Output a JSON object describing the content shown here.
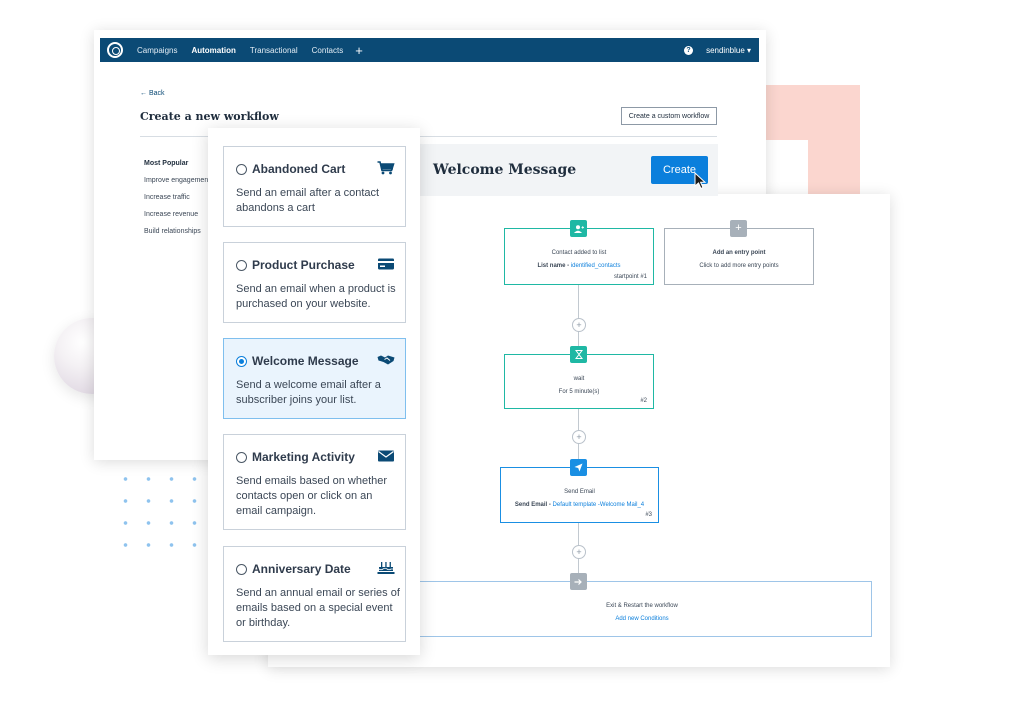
{
  "colors": {
    "navy": "#0b4a75",
    "primary": "#0b7fdc",
    "teal": "#1fb8a4",
    "grey_icon": "#a7b0b9",
    "selected_bg": "#eaf4fd"
  },
  "nav": {
    "items": [
      {
        "label": "Campaigns",
        "active": false
      },
      {
        "label": "Automation",
        "active": true
      },
      {
        "label": "Transactional",
        "active": false
      },
      {
        "label": "Contacts",
        "active": false
      }
    ],
    "plus": "+",
    "help": "?",
    "account": "sendinblue ▾"
  },
  "page": {
    "back": "← Back",
    "title": "Create a new workflow",
    "custom_button": "Create a custom workflow",
    "categories": [
      "Most Popular",
      "Improve engagement",
      "Increase traffic",
      "Increase revenue",
      "Build relationships"
    ]
  },
  "templates": [
    {
      "title": "Abandoned Cart",
      "desc": "Send an email after a contact abandons a cart",
      "icon": "cart-icon",
      "selected": false
    },
    {
      "title": "Product Purchase",
      "desc": "Send an email when a product is purchased on your website.",
      "icon": "credit-card-icon",
      "selected": false
    },
    {
      "title": "Welcome Message",
      "desc": "Send a welcome email after a subscriber joins your list.",
      "icon": "handshake-icon",
      "selected": true
    },
    {
      "title": "Marketing Activity",
      "desc": "Send emails based on whether contacts open or click on an email campaign.",
      "icon": "envelope-icon",
      "selected": false
    },
    {
      "title": "Anniversary Date",
      "desc": "Send an annual email or series of emails based on a special event or birthday.",
      "icon": "cake-icon",
      "selected": false
    }
  ],
  "workflow": {
    "title": "Welcome Message",
    "create_button": "Create",
    "start": {
      "title": "Contact added to list",
      "label": "List name - ",
      "value": "identified_contacts",
      "num": "startpoint #1"
    },
    "entry": {
      "title": "Add an entry point",
      "subtitle": "Click to add more entry points"
    },
    "wait": {
      "title": "wait",
      "subtitle": "For 5 minute(s)",
      "num": "#2"
    },
    "send": {
      "title": "Send Email",
      "label": "Send Email - ",
      "value": "Default template -Welcome Mail_4",
      "num": "#3"
    },
    "exit": {
      "title": "Exit & Restart the workflow",
      "link": "Add new Conditions"
    },
    "plus": "+"
  }
}
